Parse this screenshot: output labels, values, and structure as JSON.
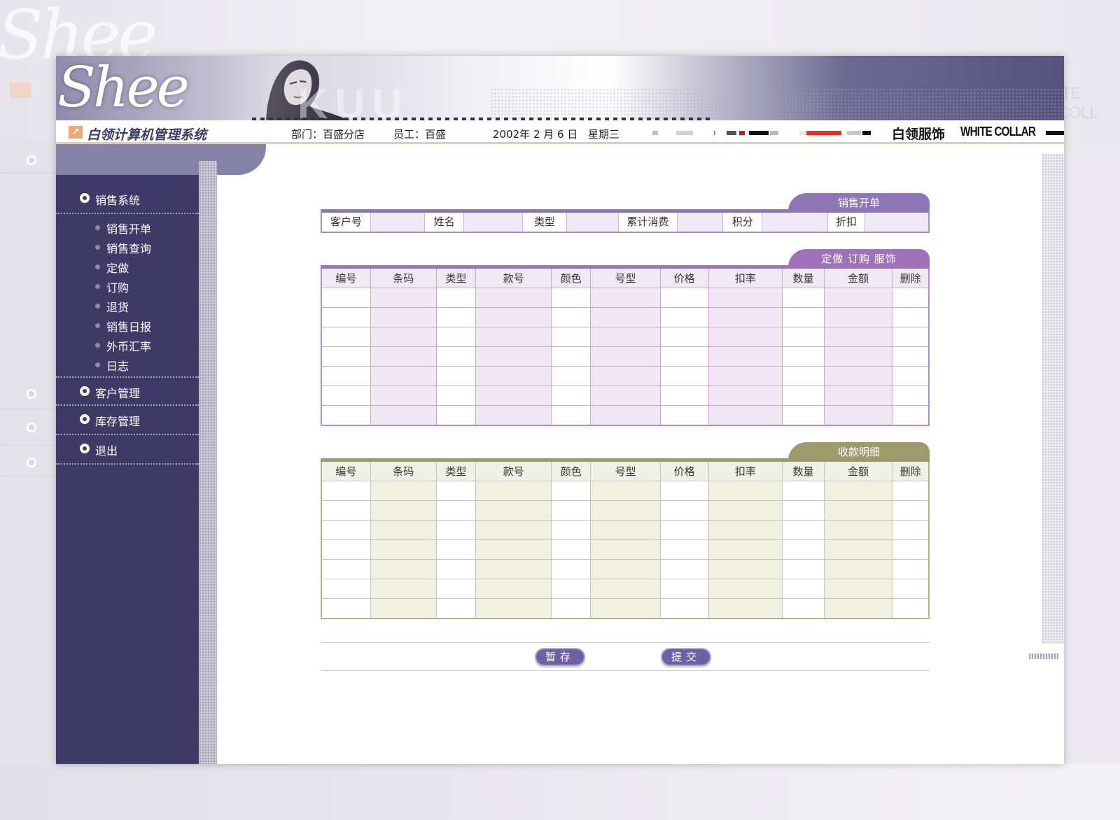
{
  "header": {
    "logo_text": "Shee",
    "system_title": "白领计算机管理系统",
    "department": "部门：百盛分店",
    "employee": "员工：百盛",
    "date": "2002年 2 月 6 日",
    "weekday": "星期三",
    "brand_cn": "白领服饰",
    "brand_en": "WHITE COLLAR"
  },
  "sidebar": {
    "sections": [
      {
        "label": "销售系统"
      },
      {
        "label": "客户管理"
      },
      {
        "label": "库存管理"
      },
      {
        "label": "退出"
      }
    ],
    "sales_items": [
      {
        "label": "销售开单"
      },
      {
        "label": "销售查询"
      },
      {
        "label": "定做"
      },
      {
        "label": "订购"
      },
      {
        "label": "退货"
      },
      {
        "label": "销售日报"
      },
      {
        "label": "外币汇率"
      },
      {
        "label": "日志"
      }
    ]
  },
  "customer_panel": {
    "tab": "销售开单",
    "fields": [
      "客户号",
      "姓名",
      "类型",
      "累计消费",
      "积分",
      "折扣"
    ]
  },
  "items_panel": {
    "tab": "定做  订购  服饰",
    "columns": [
      "编号",
      "条码",
      "类型",
      "款号",
      "颜色",
      "号型",
      "价格",
      "扣率",
      "数量",
      "金额",
      "删除"
    ]
  },
  "payment_panel": {
    "tab": "收款明细",
    "columns": [
      "编号",
      "条码",
      "类型",
      "款号",
      "颜色",
      "号型",
      "价格",
      "扣率",
      "数量",
      "金额",
      "删除"
    ]
  },
  "actions": {
    "save_label": "暂存",
    "submit_label": "提交"
  },
  "colors": {
    "sidebar": "#3f3a66",
    "purple_accent": "#8e76b6",
    "olive_accent": "#9d9b6c",
    "button": "#6f5fa3"
  }
}
